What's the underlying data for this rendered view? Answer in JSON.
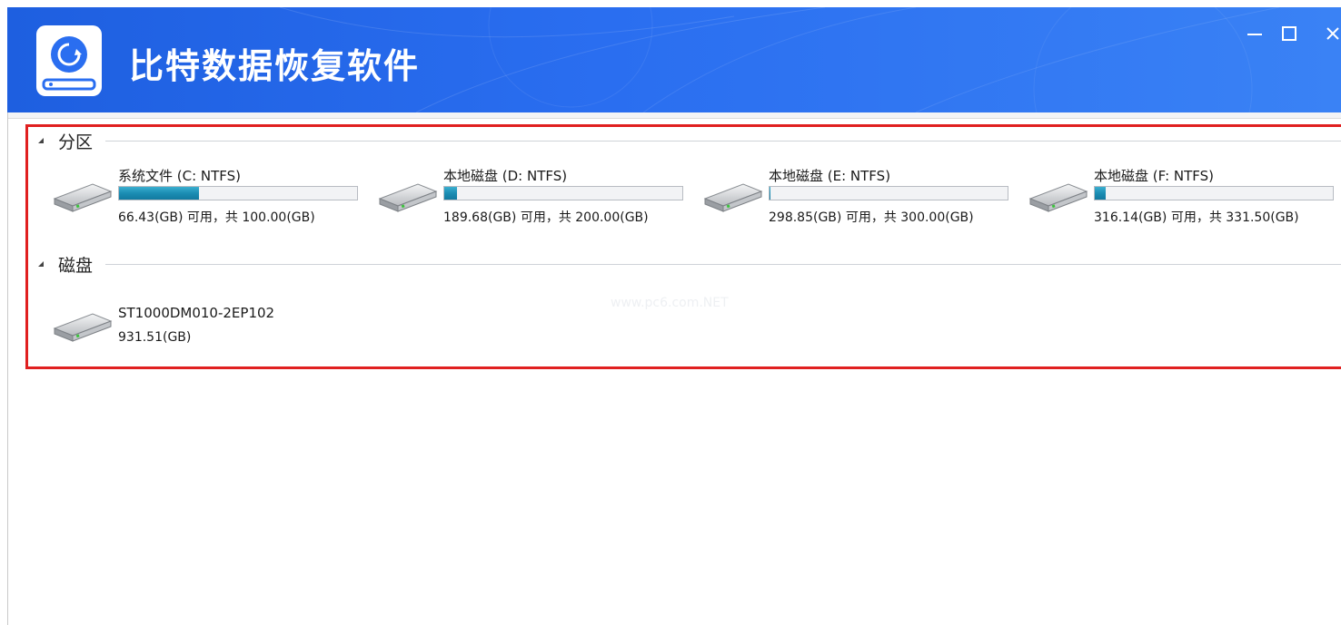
{
  "app": {
    "title": "比特数据恢复软件",
    "accent_color": "#2a6ef0"
  },
  "window_controls": {
    "minimize_icon": "minimize-icon",
    "maximize_icon": "maximize-icon",
    "close_icon": "close-icon"
  },
  "sections": {
    "partitions": {
      "title": "分区",
      "items": [
        {
          "label": "系统文件 (C: NTFS)",
          "free_text": "66.43(GB) 可用，共 100.00(GB)",
          "used_fraction": 0.3357
        },
        {
          "label": "本地磁盘 (D: NTFS)",
          "free_text": "189.68(GB) 可用，共 200.00(GB)",
          "used_fraction": 0.0516
        },
        {
          "label": "本地磁盘 (E: NTFS)",
          "free_text": "298.85(GB) 可用，共 300.00(GB)",
          "used_fraction": 0.0038
        },
        {
          "label": "本地磁盘 (F: NTFS)",
          "free_text": "316.14(GB) 可用，共 331.50(GB)",
          "used_fraction": 0.0463
        }
      ]
    },
    "disks": {
      "title": "磁盘",
      "items": [
        {
          "label": "ST1000DM010-2EP102",
          "size_text": "931.51(GB)"
        }
      ]
    }
  },
  "watermark": "www.pc6.com.NET",
  "highlight_color": "#e02020"
}
